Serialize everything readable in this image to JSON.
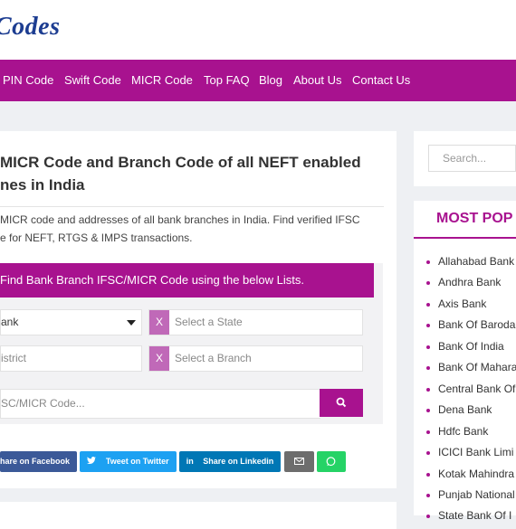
{
  "header": {
    "logo_text": "Codes"
  },
  "nav": {
    "items": [
      "PIN Code",
      "Swift Code",
      "MICR Code",
      "Top FAQ",
      "Blog",
      "About Us",
      "Contact Us"
    ]
  },
  "main": {
    "title_line1": "MICR Code and Branch Code of all NEFT enabled",
    "title_line2": "nes in India",
    "desc_line1": "MICR code and addresses of all bank branches in India. Find verified IFSC",
    "desc_line2": "e for NEFT, RTGS & IMPS transactions."
  },
  "finder": {
    "heading": "Find Bank Branch IFSC/MICR Code using the below Lists.",
    "bank_value": "ank",
    "state_placeholder": "Select a State",
    "district_placeholder": "istrict",
    "branch_placeholder": "Select a Branch",
    "code_placeholder": "SC/MICR Code...",
    "clear_label": "X"
  },
  "share": {
    "facebook": "hare on Facebook",
    "twitter": "Tweet on Twitter",
    "linkedin": "Share on Linkedin",
    "linkedin_icon": "in",
    "colors": {
      "facebook": "#3b5998",
      "twitter": "#1da1f2",
      "linkedin": "#0077b5",
      "email": "#6d6d6d",
      "whatsapp": "#25d366"
    }
  },
  "sidebar": {
    "search_placeholder": "Search...",
    "popular_title": "MOST POP",
    "banks": [
      "Allahabad Bank",
      "Andhra Bank",
      "Axis Bank",
      "Bank Of Baroda",
      "Bank Of India",
      "Bank Of Mahara",
      "Central Bank Of",
      "Dena Bank",
      "Hdfc Bank",
      "ICICI Bank Limi",
      "Kotak Mahindra",
      "Punjab National",
      "State Bank Of I"
    ]
  },
  "colors": {
    "brand": "#a8128f",
    "logo": "#1d3d91"
  }
}
